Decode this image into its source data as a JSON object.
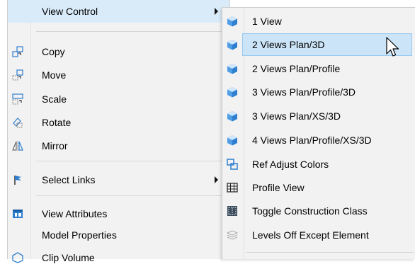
{
  "left_menu": {
    "items": [
      {
        "label": "View Control",
        "icon": "none",
        "submenu": true,
        "highlighted": true
      },
      {
        "label": "Copy",
        "icon": "copy-icon"
      },
      {
        "label": "Move",
        "icon": "move-icon"
      },
      {
        "label": "Scale",
        "icon": "scale-icon"
      },
      {
        "label": "Rotate",
        "icon": "rotate-icon"
      },
      {
        "label": "Mirror",
        "icon": "mirror-icon"
      },
      {
        "label": "Select Links",
        "icon": "flag-icon",
        "submenu": true
      },
      {
        "label": "View Attributes",
        "icon": "view-attributes-icon"
      },
      {
        "label": "Model Properties",
        "icon": "none"
      },
      {
        "label": "Clip Volume",
        "icon": "clip-volume-icon"
      }
    ]
  },
  "view_control_submenu": {
    "items": [
      {
        "label": "1 View",
        "icon": "cube-icon"
      },
      {
        "label": "2 Views Plan/3D",
        "icon": "cube-icon",
        "highlighted": true
      },
      {
        "label": "2 Views Plan/Profile",
        "icon": "cube-icon"
      },
      {
        "label": "3 Views Plan/Profile/3D",
        "icon": "cube-icon"
      },
      {
        "label": "3 Views Plan/XS/3D",
        "icon": "cube-icon"
      },
      {
        "label": "4 Views Plan/Profile/XS/3D",
        "icon": "cube-icon"
      },
      {
        "label": "Ref Adjust Colors",
        "icon": "ref-adjust-colors-icon"
      },
      {
        "label": "Profile View",
        "icon": "profile-view-icon"
      },
      {
        "label": "Toggle Construction Class",
        "icon": "toggle-construction-class-icon"
      },
      {
        "label": "Levels Off Except Element",
        "icon": "levels-off-icon"
      }
    ]
  },
  "colors": {
    "menu_background": "#f2f2f2",
    "highlight": "#cce4f7",
    "icon_blue": "#2e7fd0"
  }
}
